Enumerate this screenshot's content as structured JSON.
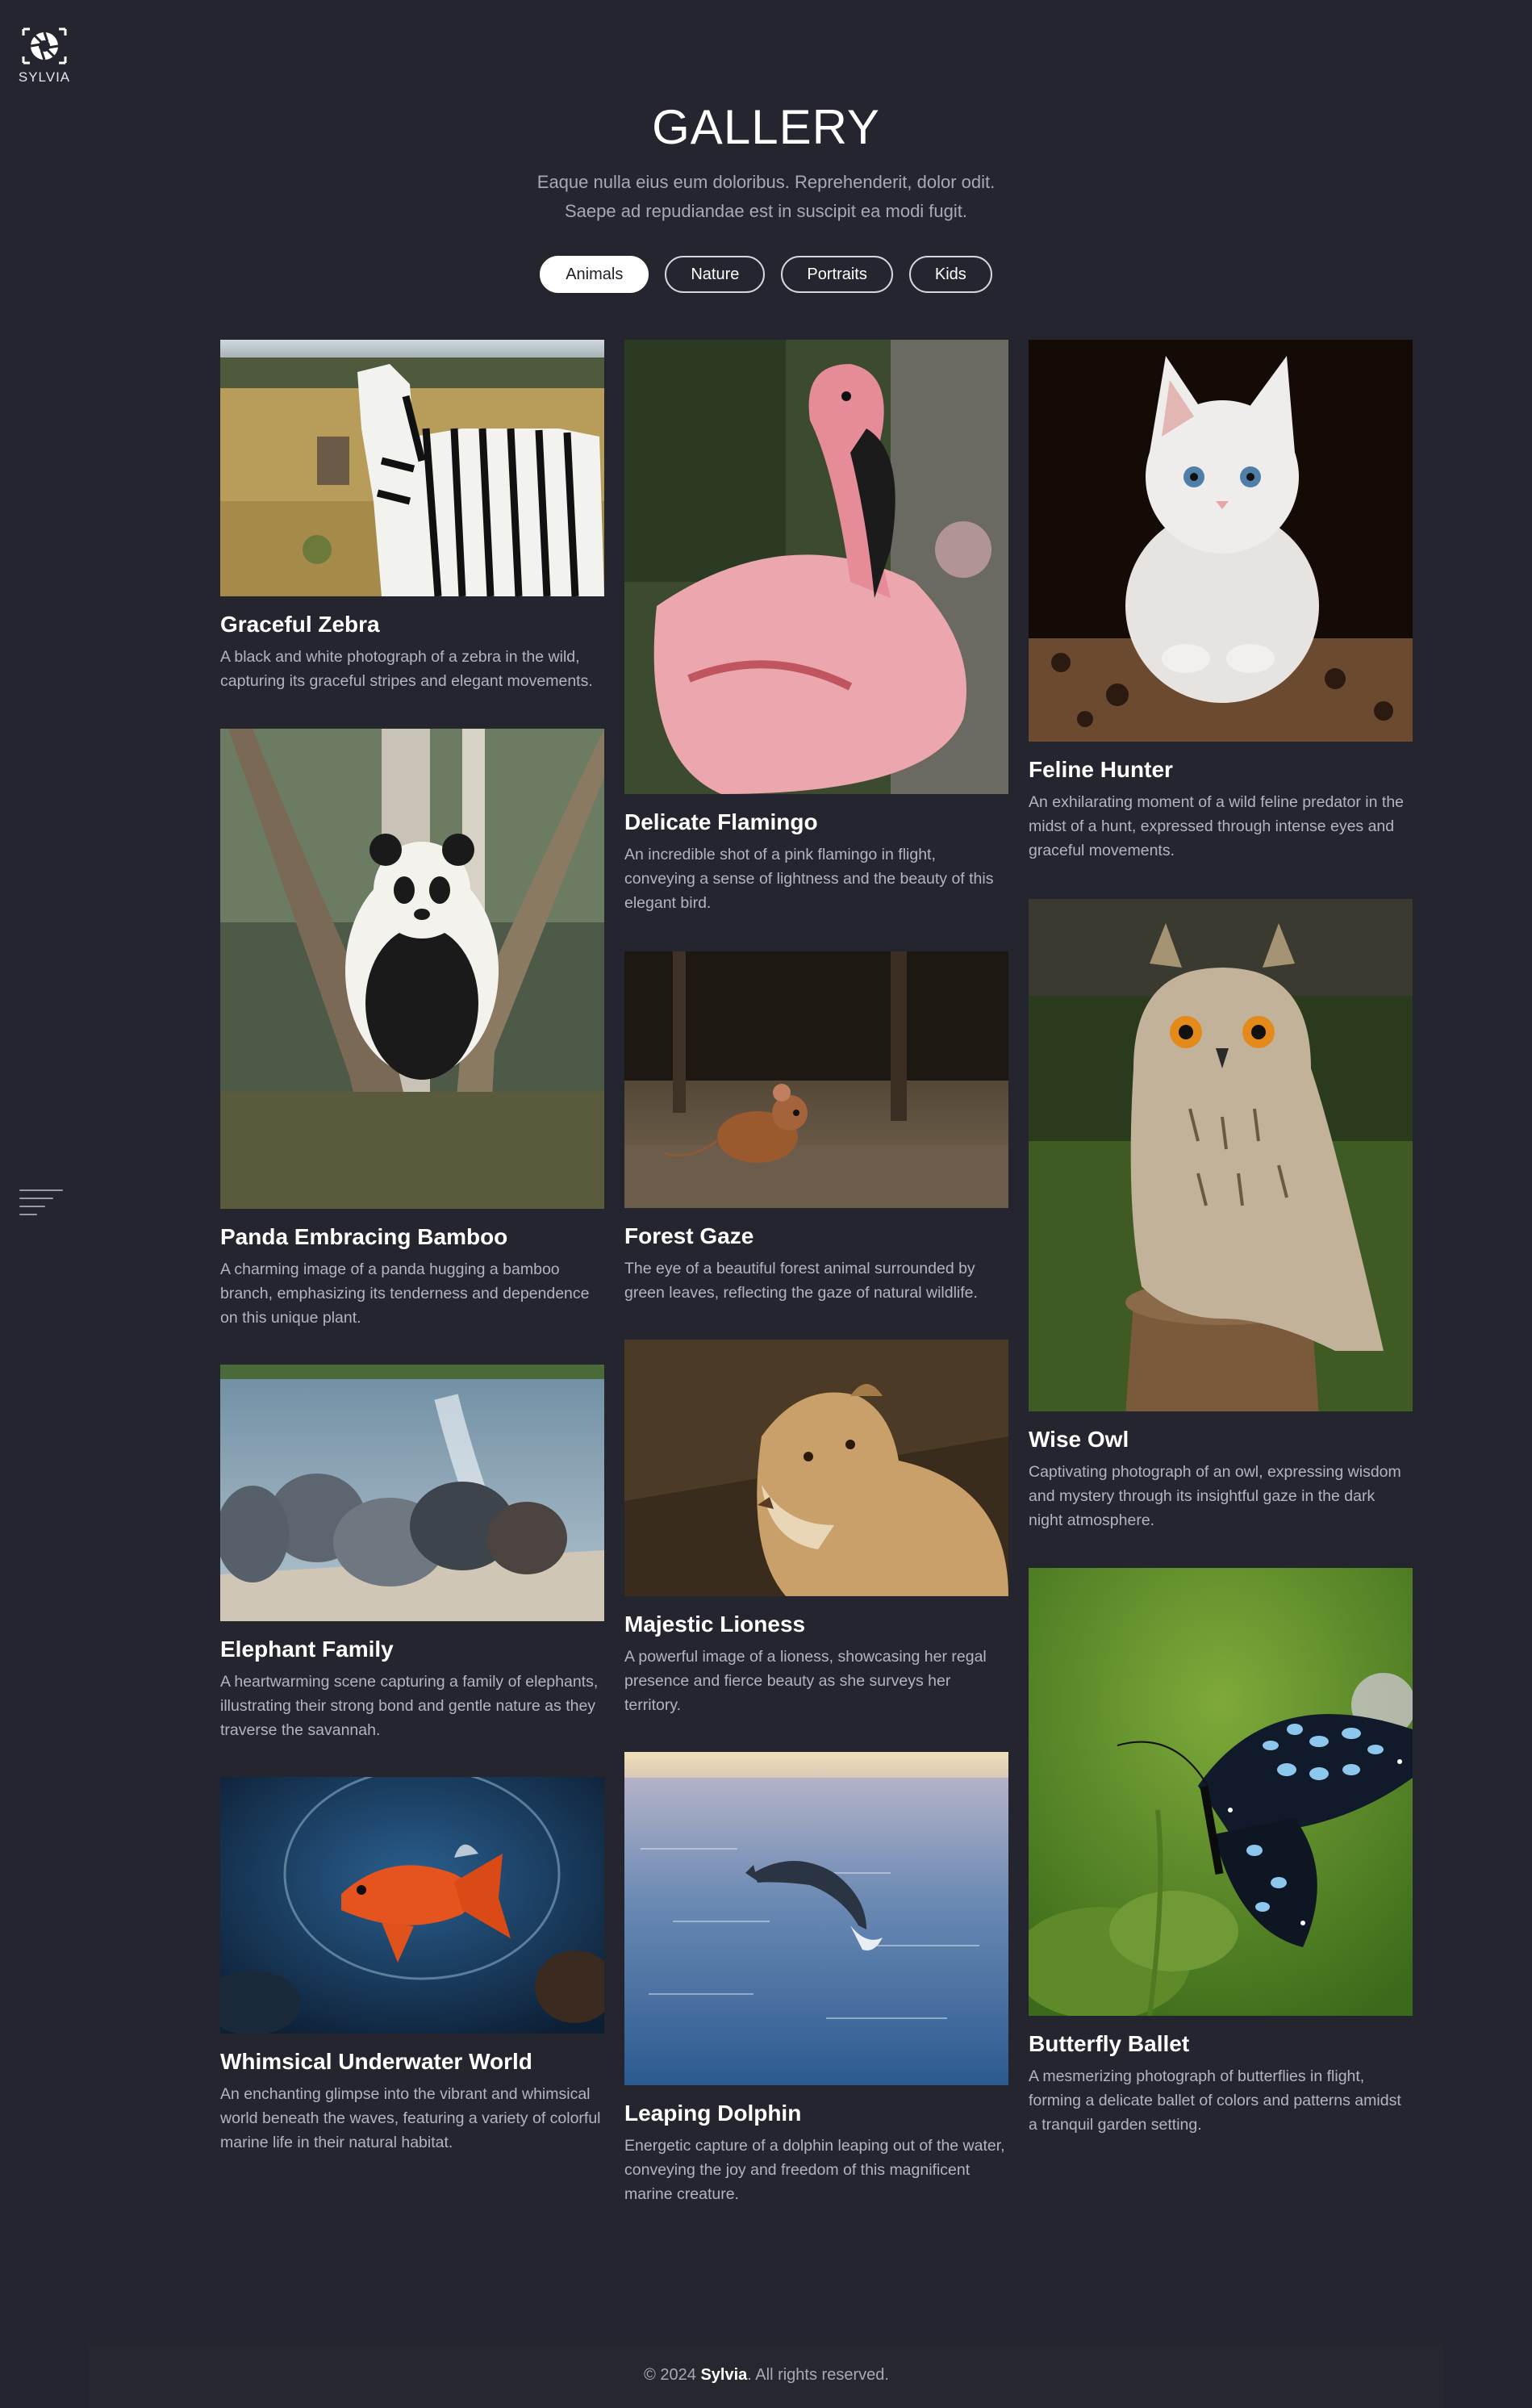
{
  "brand": {
    "name": "SYLVIA"
  },
  "header": {
    "title": "GALLERY",
    "subtitle_line1": "Eaque nulla eius eum doloribus. Reprehenderit, dolor odit.",
    "subtitle_line2": "Saepe ad repudiandae est in suscipit ea modi fugit."
  },
  "filters": [
    {
      "label": "Animals",
      "active": true
    },
    {
      "label": "Nature",
      "active": false
    },
    {
      "label": "Portraits",
      "active": false
    },
    {
      "label": "Kids",
      "active": false
    }
  ],
  "gallery": [
    {
      "title": "Graceful Zebra",
      "description": "A black and white photograph of a zebra in the wild, capturing its graceful stripes and elegant movements.",
      "image": "zebra-photo"
    },
    {
      "title": "Delicate Flamingo",
      "description": "An incredible shot of a pink flamingo in flight, conveying a sense of lightness and the beauty of this elegant bird.",
      "image": "flamingo-photo"
    },
    {
      "title": "Feline Hunter",
      "description": "An exhilarating moment of a wild feline predator in the midst of a hunt, expressed through intense eyes and graceful movements.",
      "image": "kitten-photo"
    },
    {
      "title": "Panda Embracing Bamboo",
      "description": "A charming image of a panda hugging a bamboo branch, emphasizing its tenderness and dependence on this unique plant.",
      "image": "panda-photo"
    },
    {
      "title": "Forest Gaze",
      "description": "The eye of a beautiful forest animal surrounded by green leaves, reflecting the gaze of natural wildlife.",
      "image": "mouse-photo"
    },
    {
      "title": "Wise Owl",
      "description": "Captivating photograph of an owl, expressing wisdom and mystery through its insightful gaze in the dark night atmosphere.",
      "image": "owl-photo"
    },
    {
      "title": "Elephant Family",
      "description": "A heartwarming scene capturing a family of elephants, illustrating their strong bond and gentle nature as they traverse the savannah.",
      "image": "elephants-photo"
    },
    {
      "title": "Majestic Lioness",
      "description": "A powerful image of a lioness, showcasing her regal presence and fierce beauty as she surveys her territory.",
      "image": "lioness-photo"
    },
    {
      "title": "Butterfly Ballet",
      "description": "A mesmerizing photograph of butterflies in flight, forming a delicate ballet of colors and patterns amidst a tranquil garden setting.",
      "image": "butterfly-photo"
    },
    {
      "title": "Whimsical Underwater World",
      "description": "An enchanting glimpse into the vibrant and whimsical world beneath the waves, featuring a variety of colorful marine life in their natural habitat.",
      "image": "fish-photo"
    },
    {
      "title": "Leaping Dolphin",
      "description": "Energetic capture of a dolphin leaping out of the water, conveying the joy and freedom of this magnificent marine creature.",
      "image": "dolphin-photo"
    }
  ],
  "footer": {
    "copyright": "© 2024",
    "brand": "Sylvia",
    "rights": ". All rights reserved."
  },
  "colors": {
    "background": "#25252f",
    "text": "#ffffff",
    "muted": "#b4b4be"
  }
}
